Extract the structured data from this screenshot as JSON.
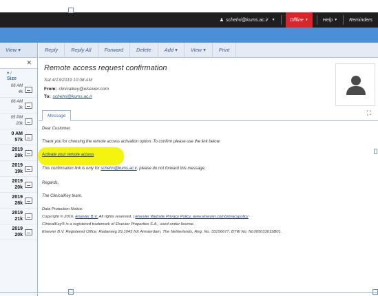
{
  "topbar": {
    "user": "schehri@kums.ac.ir",
    "status": "Offline",
    "help": "Help",
    "reminders": "Reminders"
  },
  "left": {
    "view_label": "View ▾",
    "size_top": "▾ /",
    "size_label": "Size",
    "items": [
      {
        "date": "06 AM",
        "size": "4k",
        "bold": false
      },
      {
        "date": "06 AM",
        "size": "3k",
        "bold": false
      },
      {
        "date": "05 PM",
        "size": "20k",
        "bold": false
      },
      {
        "date": "0 AM",
        "size": "57k",
        "bold": true
      },
      {
        "date": "2019",
        "size": "28k",
        "bold": true
      },
      {
        "date": "2019",
        "size": "19k",
        "bold": true
      },
      {
        "date": "2019",
        "size": "20k",
        "bold": true
      },
      {
        "date": "2019",
        "size": "28k",
        "bold": true
      },
      {
        "date": "2019",
        "size": "21k",
        "bold": true
      },
      {
        "date": "2019",
        "size": "20k",
        "bold": true
      }
    ]
  },
  "toolbar": {
    "reply": "Reply",
    "reply_all": "Reply All",
    "forward": "Forward",
    "delete": "Delete",
    "add": "Add ▾",
    "view": "View ▾",
    "print": "Print"
  },
  "message": {
    "subject": "Remote access request confirmation",
    "date": "Sat 4/13/2019 10:08 AM",
    "from_label": "From:",
    "from": "clinicalkey@elsevier.com",
    "to_label": "To:",
    "to": "schehri@kums.ac.ir",
    "tab": "Message",
    "greeting": "Dear Customer,",
    "para1": "Thank you for choosing the remote access activation option. To confirm please use the link below:",
    "activate_link": "Activate your remote access",
    "para2_a": "This confirmation link is only for ",
    "para2_email": "schehri@kums.ac.ir",
    "para2_b": ", please do not forward this message.",
    "regards": "Regards,",
    "team": "The ClinicalKey team.",
    "notice_title": "Data Protection Notice:",
    "copyright_a": "Copyright © 2016. ",
    "copyright_link1": "Elsevier B.V.",
    "copyright_b": " All rights reserved. | ",
    "copyright_link2": "Elsevier Website Privacy Policy, www.elsevier.com/privacypolicy",
    "trademark": "ClinicalKey® is a registered trademark of Elsevier Properties S.A., used under license.",
    "registered": "Elsevier B.V. Registered Office: Radarweg 29,1043 NX Amsterdam, The Netherlands, Reg. No. 33156677, BTW No. NL005033019B01."
  },
  "colors": {
    "accent": "#4b8fd6",
    "offline": "#d9252b",
    "highlight": "#f4f40c"
  }
}
